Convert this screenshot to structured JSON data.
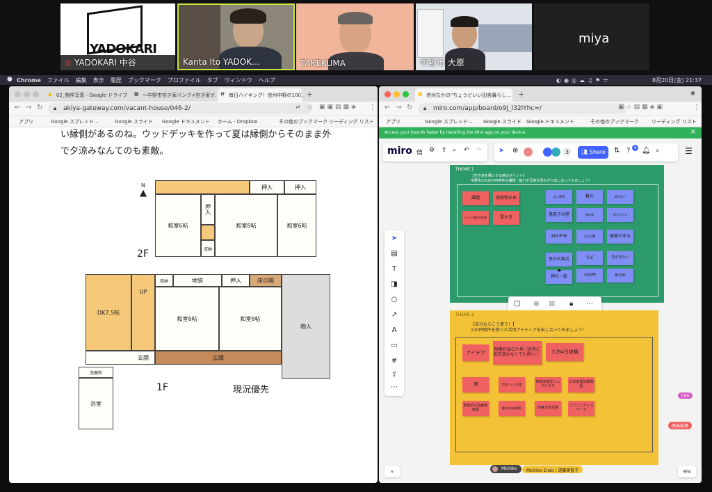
{
  "zoom": {
    "participants": [
      {
        "name": "YADOKARI 中谷",
        "logo": "YADOKARI",
        "muted": true
      },
      {
        "name": "Kanta Ito YADOK…",
        "muted": false
      },
      {
        "name": "TAKEKUMA",
        "muted": false
      },
      {
        "name": "中野市 大原",
        "muted": false
      },
      {
        "name": "miya",
        "muted": false
      }
    ]
  },
  "menubar": {
    "app": "Chrome",
    "items": [
      "ファイル",
      "編集",
      "表示",
      "履歴",
      "ブックマーク",
      "プロファイル",
      "タブ",
      "ウィンドウ",
      "ヘルプ"
    ],
    "clock": "8月20日(金) 21:37"
  },
  "left": {
    "tabs": [
      "02_物件写真 - Google ドライブ",
      "〜中野市空き家バンク×空き家ゲ…",
      "毎日ハイキング！信州中野の100万…"
    ],
    "url": "akiya-gateway.com/vacant-house/046-2/",
    "bookmarks": [
      "アプリ",
      "Google スプレッド…",
      "Google スライド",
      "Google ドキュメント",
      "ホーム - Dropbox",
      "その他のブックマーク",
      "リーディング リスト"
    ],
    "text_line1": "い縁側があるのね。ウッドデッキを作って夏は縁側からそのまま外",
    "text_line2": "で夕涼みなんてのも素敵。",
    "floorplan": {
      "north": "N",
      "floor2": "2F",
      "floor1": "1F",
      "note": "現況優先",
      "rooms2": [
        "押入",
        "押入",
        "和室6帖",
        "押入",
        "和室8帖",
        "和室6帖",
        "収納"
      ],
      "rooms1": [
        "収納",
        "地袋",
        "押入",
        "床の間",
        "DK7.5帖",
        "UP",
        "和室8帖",
        "和室8帖",
        "物入",
        "玄関",
        "広縁",
        "洗面所",
        "浴室"
      ]
    }
  },
  "right": {
    "tab": "信州なかの\"ちょうどいい田舎暮らし…",
    "url": "miro.com/app/board/o9J_l32lYhc=/",
    "bookmarks": [
      "アプリ",
      "Google スプレッド…",
      "Google スライド",
      "Google ドキュメント",
      "その他のブックマーク",
      "リーディング リスト"
    ],
    "banner_text": "Access your boards faster by installing the Miro app on your device.",
    "brand": "miro",
    "board_title": "信",
    "share_label": "Share",
    "user_count": "3",
    "notif_count": "4",
    "theme1": {
      "label": "THEME 1",
      "title": "【空き家を購入する時のポイント】",
      "subtitle": "中野市の100万円物件の課題・魅力を写真を見ながら出し合ってみましょう！",
      "red_notes": [
        "課題",
        "残地物多め",
        "トイレ改修が必要",
        "雪かき"
      ],
      "blue_notes": [
        "広い縁側",
        "魅力",
        "庭が広い",
        "落書きの壁",
        "囲炉裏",
        "484平米",
        "北山の麓",
        "薪ストーブ",
        "窓のお風呂",
        "うど",
        "空がきれい",
        "神社・能",
        "100円",
        "8LDK",
        "果樹がある",
        "地元の人々"
      ]
    },
    "theme2": {
      "label": "THEME 2",
      "title": "【自分ならこう使う！】",
      "subtitle": "100円物件を使った活用アイディアを出し合ってみましょう！",
      "notes": [
        "アイデア",
        "映像作品ロケ地（近所に気を遣わなくても良い。）",
        "３泊4日体験",
        "畑",
        "音楽フェス会場",
        "地域点描注シェアハウス",
        "日本家屋体験施設",
        "剣道的な高齢者施設",
        "農山村の体験所",
        "田舎文化体験",
        "コミュニティスペース"
      ]
    },
    "cursors": [
      {
        "name": "noe"
      },
      {
        "name": "西出裕貴"
      }
    ],
    "collaborators": [
      "Michiko",
      "Michiko Endo / 遠藤美智子"
    ],
    "zoom_level": "9%"
  },
  "colors": {
    "miro_green": "#2d9a6c",
    "miro_yellow": "#f4c236",
    "sticky_red": "#f06161",
    "sticky_blue": "#7e8ef5",
    "accent": "#4262ff"
  }
}
